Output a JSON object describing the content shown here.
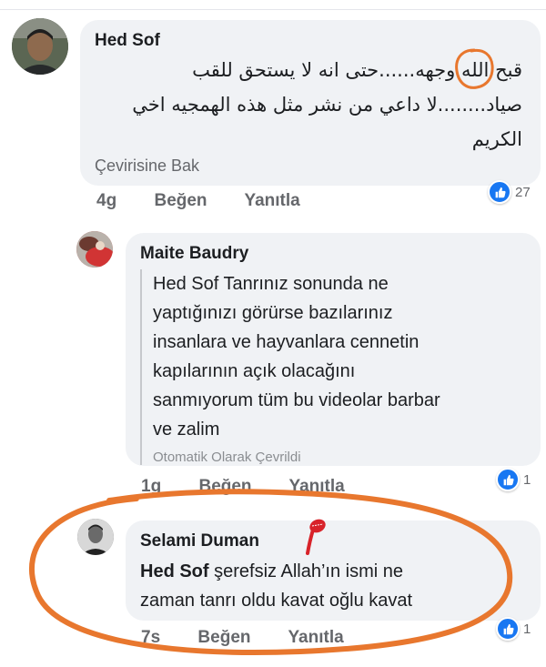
{
  "comments": [
    {
      "author": "Hed Sof",
      "text_lines": [
        "قبح الله وجهه......حتى انه لا يستحق للقب",
        "صياد........لا داعي من نشر مثل هذه الهمجيه اخي",
        "الكريم"
      ],
      "see_translation": "Çevirisine Bak",
      "time": "4g",
      "like_label": "Beğen",
      "reply_label": "Yanıtla",
      "reaction_count": "27"
    },
    {
      "author": "Maite Baudry",
      "text_lines": [
        "Hed Sof Tanrınız sonunda ne",
        "yaptığınızı görürse bazılarınız",
        "insanlara ve hayvanlara cennetin",
        "kapılarının açık olacağını",
        "sanmıyorum tüm bu videolar barbar",
        "ve zalim"
      ],
      "auto_translated": "Otomatik Olarak Çevrildi",
      "time": "1g",
      "like_label": "Beğen",
      "reply_label": "Yanıtla",
      "reaction_count": "1"
    },
    {
      "author": "Selami Duman",
      "mention": "Hed Sof",
      "text_line1_rest": " şerefsiz Allah’ın ismi ne",
      "text_line2": "zaman tanrı oldu kavat oğlu kavat",
      "time": "7s",
      "like_label": "Beğen",
      "reply_label": "Yanıtla",
      "reaction_count": "1"
    }
  ],
  "colors": {
    "bubble": "#f0f2f5",
    "like_blue": "#1877f2",
    "annotation_orange": "#e8772e",
    "stamp_red": "#d8232a"
  },
  "icons": [
    "like-icon",
    "thumbs-up-icon",
    "avatar-image",
    "red-stamp-icon"
  ]
}
